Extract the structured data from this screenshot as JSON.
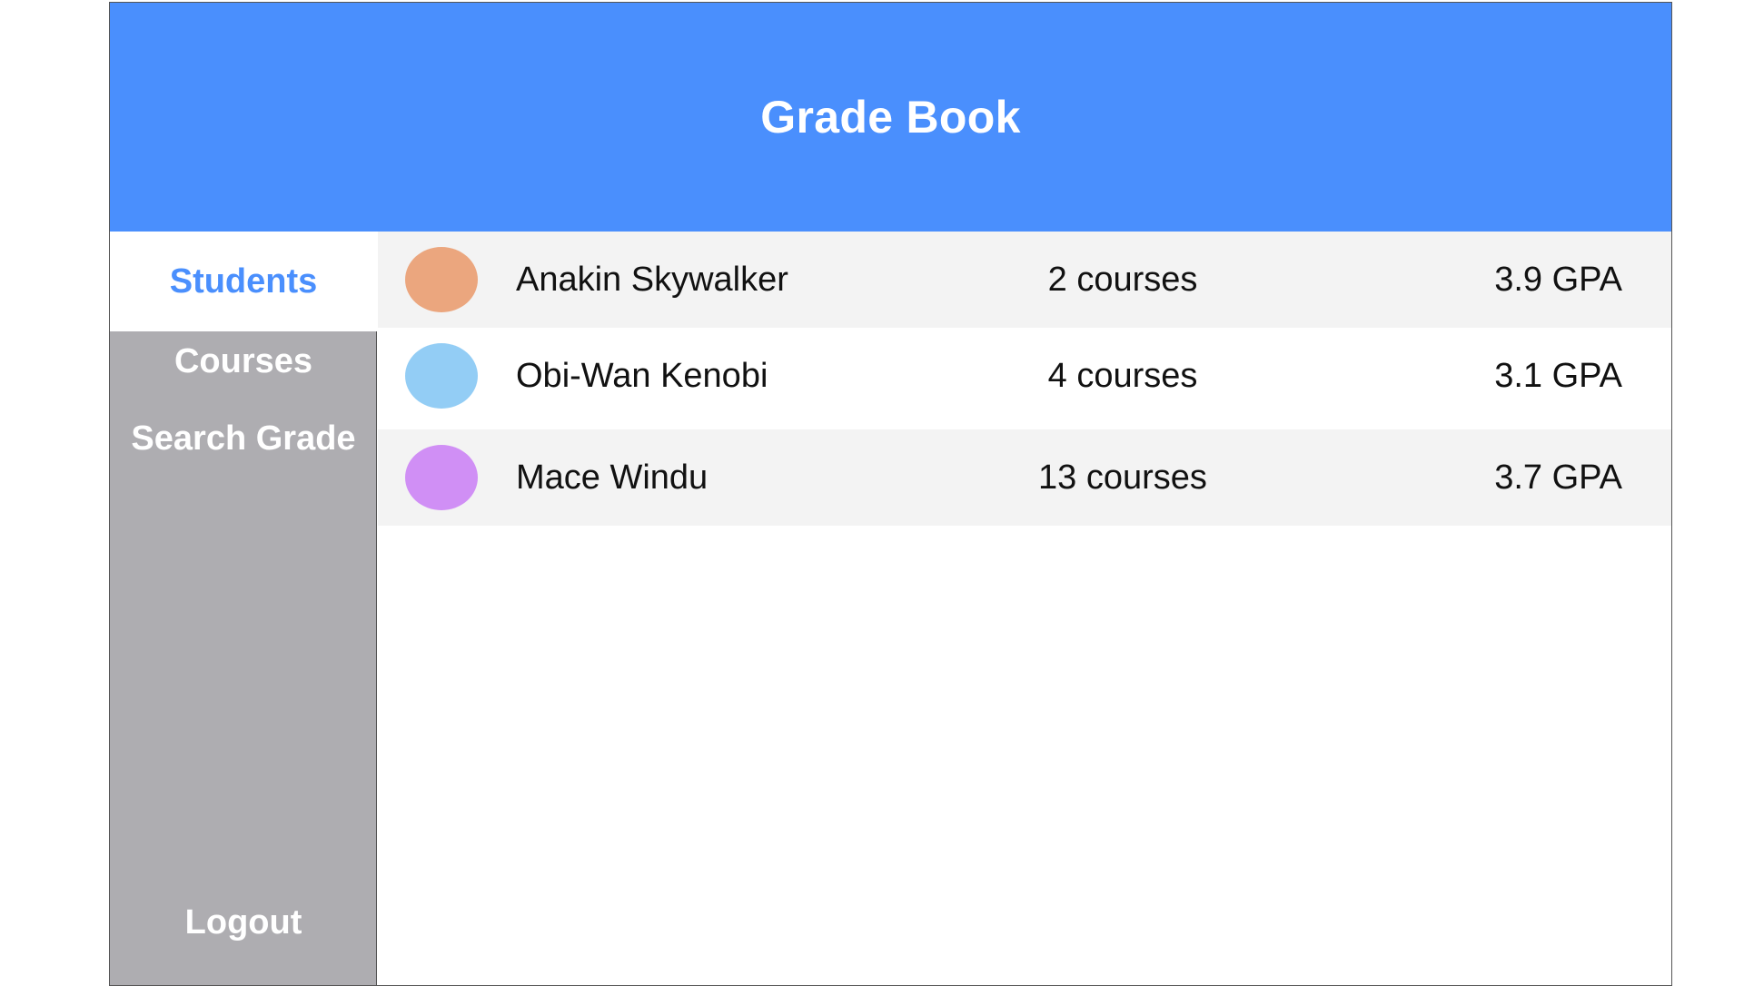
{
  "app": {
    "title": "Grade Book"
  },
  "sidebar": {
    "items": [
      {
        "label": "Students",
        "active": true
      },
      {
        "label": "Courses",
        "active": false
      },
      {
        "label": "Search Grade",
        "active": false
      }
    ],
    "logout_label": "Logout"
  },
  "students": [
    {
      "name": "Anakin Skywalker",
      "courses": "2 courses",
      "gpa": "3.9 GPA",
      "avatar_color": "#eba67e"
    },
    {
      "name": "Obi-Wan Kenobi",
      "courses": "4 courses",
      "gpa": "3.1 GPA",
      "avatar_color": "#93cdf5"
    },
    {
      "name": "Mace Windu",
      "courses": "13 courses",
      "gpa": "3.7 GPA",
      "avatar_color": "#d08ff5"
    }
  ],
  "colors": {
    "header_bg": "#4a8ffd",
    "accent": "#4a8ffd",
    "sidebar_bg": "#aeadb1",
    "row_shade": "#f3f3f3"
  }
}
